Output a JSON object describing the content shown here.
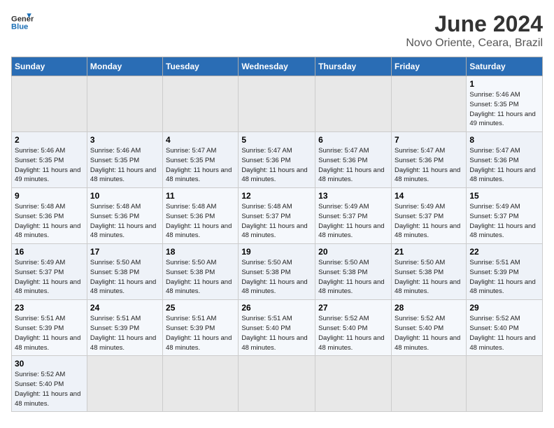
{
  "header": {
    "logo_general": "General",
    "logo_blue": "Blue",
    "title": "June 2024",
    "subtitle": "Novo Oriente, Ceara, Brazil"
  },
  "days_of_week": [
    "Sunday",
    "Monday",
    "Tuesday",
    "Wednesday",
    "Thursday",
    "Friday",
    "Saturday"
  ],
  "weeks": [
    [
      {
        "day": "",
        "info": ""
      },
      {
        "day": "",
        "info": ""
      },
      {
        "day": "",
        "info": ""
      },
      {
        "day": "",
        "info": ""
      },
      {
        "day": "",
        "info": ""
      },
      {
        "day": "",
        "info": ""
      },
      {
        "day": "1",
        "info": "Sunrise: 5:46 AM\nSunset: 5:35 PM\nDaylight: 11 hours and 49 minutes."
      }
    ],
    [
      {
        "day": "2",
        "info": "Sunrise: 5:46 AM\nSunset: 5:35 PM\nDaylight: 11 hours and 49 minutes."
      },
      {
        "day": "3",
        "info": "Sunrise: 5:46 AM\nSunset: 5:35 PM\nDaylight: 11 hours and 48 minutes."
      },
      {
        "day": "4",
        "info": "Sunrise: 5:47 AM\nSunset: 5:35 PM\nDaylight: 11 hours and 48 minutes."
      },
      {
        "day": "5",
        "info": "Sunrise: 5:47 AM\nSunset: 5:36 PM\nDaylight: 11 hours and 48 minutes."
      },
      {
        "day": "6",
        "info": "Sunrise: 5:47 AM\nSunset: 5:36 PM\nDaylight: 11 hours and 48 minutes."
      },
      {
        "day": "7",
        "info": "Sunrise: 5:47 AM\nSunset: 5:36 PM\nDaylight: 11 hours and 48 minutes."
      },
      {
        "day": "8",
        "info": "Sunrise: 5:47 AM\nSunset: 5:36 PM\nDaylight: 11 hours and 48 minutes."
      }
    ],
    [
      {
        "day": "9",
        "info": "Sunrise: 5:48 AM\nSunset: 5:36 PM\nDaylight: 11 hours and 48 minutes."
      },
      {
        "day": "10",
        "info": "Sunrise: 5:48 AM\nSunset: 5:36 PM\nDaylight: 11 hours and 48 minutes."
      },
      {
        "day": "11",
        "info": "Sunrise: 5:48 AM\nSunset: 5:36 PM\nDaylight: 11 hours and 48 minutes."
      },
      {
        "day": "12",
        "info": "Sunrise: 5:48 AM\nSunset: 5:37 PM\nDaylight: 11 hours and 48 minutes."
      },
      {
        "day": "13",
        "info": "Sunrise: 5:49 AM\nSunset: 5:37 PM\nDaylight: 11 hours and 48 minutes."
      },
      {
        "day": "14",
        "info": "Sunrise: 5:49 AM\nSunset: 5:37 PM\nDaylight: 11 hours and 48 minutes."
      },
      {
        "day": "15",
        "info": "Sunrise: 5:49 AM\nSunset: 5:37 PM\nDaylight: 11 hours and 48 minutes."
      }
    ],
    [
      {
        "day": "16",
        "info": "Sunrise: 5:49 AM\nSunset: 5:37 PM\nDaylight: 11 hours and 48 minutes."
      },
      {
        "day": "17",
        "info": "Sunrise: 5:50 AM\nSunset: 5:38 PM\nDaylight: 11 hours and 48 minutes."
      },
      {
        "day": "18",
        "info": "Sunrise: 5:50 AM\nSunset: 5:38 PM\nDaylight: 11 hours and 48 minutes."
      },
      {
        "day": "19",
        "info": "Sunrise: 5:50 AM\nSunset: 5:38 PM\nDaylight: 11 hours and 48 minutes."
      },
      {
        "day": "20",
        "info": "Sunrise: 5:50 AM\nSunset: 5:38 PM\nDaylight: 11 hours and 48 minutes."
      },
      {
        "day": "21",
        "info": "Sunrise: 5:50 AM\nSunset: 5:38 PM\nDaylight: 11 hours and 48 minutes."
      },
      {
        "day": "22",
        "info": "Sunrise: 5:51 AM\nSunset: 5:39 PM\nDaylight: 11 hours and 48 minutes."
      }
    ],
    [
      {
        "day": "23",
        "info": "Sunrise: 5:51 AM\nSunset: 5:39 PM\nDaylight: 11 hours and 48 minutes."
      },
      {
        "day": "24",
        "info": "Sunrise: 5:51 AM\nSunset: 5:39 PM\nDaylight: 11 hours and 48 minutes."
      },
      {
        "day": "25",
        "info": "Sunrise: 5:51 AM\nSunset: 5:39 PM\nDaylight: 11 hours and 48 minutes."
      },
      {
        "day": "26",
        "info": "Sunrise: 5:51 AM\nSunset: 5:40 PM\nDaylight: 11 hours and 48 minutes."
      },
      {
        "day": "27",
        "info": "Sunrise: 5:52 AM\nSunset: 5:40 PM\nDaylight: 11 hours and 48 minutes."
      },
      {
        "day": "28",
        "info": "Sunrise: 5:52 AM\nSunset: 5:40 PM\nDaylight: 11 hours and 48 minutes."
      },
      {
        "day": "29",
        "info": "Sunrise: 5:52 AM\nSunset: 5:40 PM\nDaylight: 11 hours and 48 minutes."
      }
    ],
    [
      {
        "day": "30",
        "info": "Sunrise: 5:52 AM\nSunset: 5:40 PM\nDaylight: 11 hours and 48 minutes."
      },
      {
        "day": "",
        "info": ""
      },
      {
        "day": "",
        "info": ""
      },
      {
        "day": "",
        "info": ""
      },
      {
        "day": "",
        "info": ""
      },
      {
        "day": "",
        "info": ""
      },
      {
        "day": "",
        "info": ""
      }
    ]
  ]
}
